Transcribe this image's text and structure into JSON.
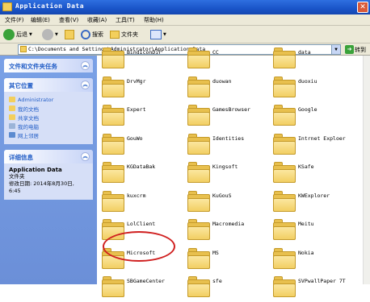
{
  "window": {
    "title": "Application Data",
    "close_glyph": "✕"
  },
  "menu": [
    "文件(F)",
    "编辑(E)",
    "查看(V)",
    "收藏(A)",
    "工具(T)",
    "帮助(H)"
  ],
  "toolbar": {
    "back": "后退",
    "search": "搜索",
    "folders": "文件夹"
  },
  "address": {
    "path": "C:\\Documents and Settings\\Administrator\\Application Data",
    "go": "转到"
  },
  "sidebar": {
    "tasks_title": "文件和文件夹任务",
    "places_title": "其它位置",
    "places": [
      "Administrator",
      "我的文档",
      "共享文档",
      "我的电脑",
      "网上邻居"
    ],
    "details_title": "详细信息",
    "details_name": "Application Data",
    "details_type": "文件夹",
    "details_modified": "修改日期: 2014年8月30日,",
    "details_time": "6:45"
  },
  "folders": [
    "BindIconDir",
    "CC",
    "data",
    "DrvMgr",
    "duowan",
    "duoxiu",
    "Expert",
    "GamesBrowser",
    "Google",
    "GouWo",
    "Identities",
    "Intrnet Exploer",
    "KGDataBak",
    "Kingsoft",
    "KSafe",
    "kuxcrm",
    "KuGouS",
    "KWExplorer",
    "LolClient",
    "Macromedia",
    "Meitu",
    "Microsoft",
    "MS",
    "Nokia",
    "SBGameCenter",
    "sfe",
    "SVPwallPaper 7T"
  ],
  "colors": {
    "titlebar": "#2e6fe0",
    "sidebar": "#7aa1e6",
    "highlight_circle": "#d02020"
  }
}
